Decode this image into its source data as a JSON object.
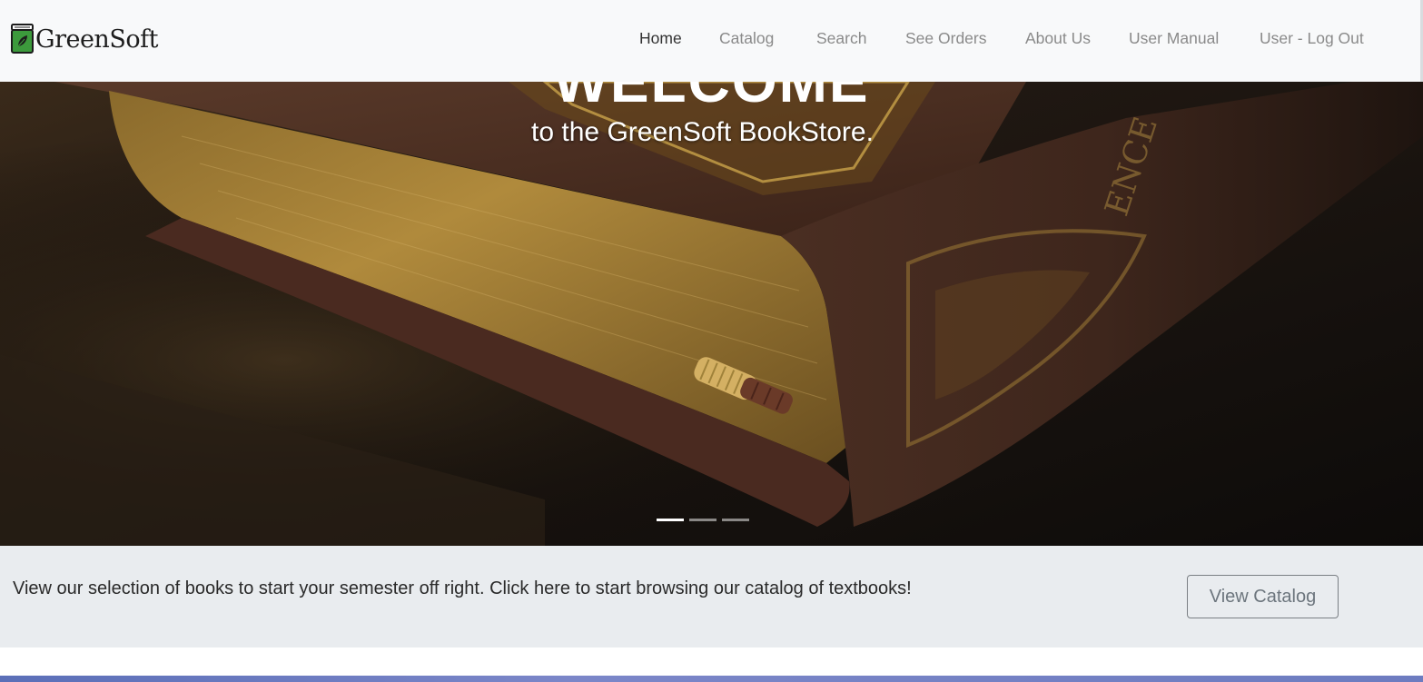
{
  "brand": {
    "name": "GreenSoft",
    "icon": "green-book-icon"
  },
  "nav": {
    "items": [
      {
        "label": "Home",
        "active": true
      },
      {
        "label": "Catalog",
        "active": false
      },
      {
        "label": "Search",
        "active": false
      },
      {
        "label": "See Orders",
        "active": false
      },
      {
        "label": "About Us",
        "active": false
      },
      {
        "label": "User Manual",
        "active": false
      },
      {
        "label": "User - Log Out",
        "active": false
      }
    ]
  },
  "hero": {
    "heading": "WELCOME",
    "subheading": "to the GreenSoft BookStore.",
    "slide_count": 3,
    "active_slide": 1
  },
  "cta": {
    "text": "View our selection of books to start your semester off right. Click here to start browsing our catalog of textbooks!",
    "button_label": "View Catalog"
  },
  "colors": {
    "navbar_bg": "#f8f9fa",
    "nav_active": "#333333",
    "nav_inactive": "#8a8a8a",
    "cta_bg": "#e9ecef",
    "brand_green": "#3c9a3c"
  }
}
